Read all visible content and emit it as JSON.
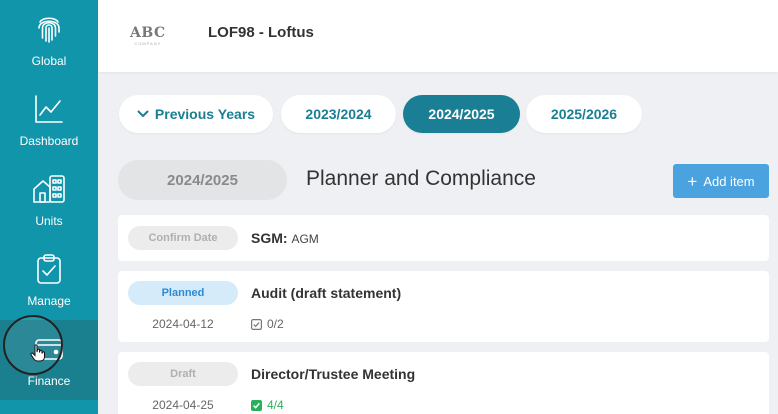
{
  "sidebar": {
    "items": [
      {
        "label": "Global",
        "icon": "fingerprint-icon"
      },
      {
        "label": "Dashboard",
        "icon": "chart-line-icon"
      },
      {
        "label": "Units",
        "icon": "building-icon"
      },
      {
        "label": "Manage",
        "icon": "clipboard-check-icon"
      },
      {
        "label": "Finance",
        "icon": "wallet-icon"
      }
    ]
  },
  "header": {
    "logo_text": "ABC",
    "logo_sub": "COMPANY",
    "title": "LOF98 - Loftus"
  },
  "years": {
    "previous_label": "Previous Years",
    "tabs": [
      "2023/2024",
      "2024/2025",
      "2025/2026"
    ],
    "active": "2024/2025"
  },
  "section": {
    "year_badge": "2024/2025",
    "title": "Planner and Compliance",
    "add_label": "Add item"
  },
  "items": [
    {
      "status": "Confirm Date",
      "title": "SGM:",
      "subtitle": "AGM"
    },
    {
      "status": "Planned",
      "title": "Audit (draft statement)",
      "date": "2024-04-12",
      "progress": "0/2"
    },
    {
      "status": "Draft",
      "title": "Director/Trustee Meeting",
      "date": "2024-04-25",
      "progress": "4/4"
    }
  ],
  "colors": {
    "sidebar": "#1195aa",
    "accent": "#1a7f94",
    "add_button": "#4aa3df",
    "done": "#2ab05c"
  }
}
